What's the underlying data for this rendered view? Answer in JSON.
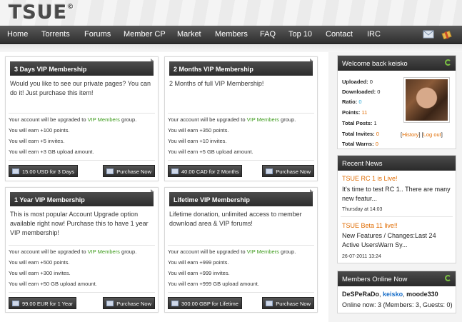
{
  "header": {
    "logo": "TSUE",
    "logo_mark": "©"
  },
  "nav": {
    "items": [
      "Home",
      "Torrents",
      "Forums",
      "Member CP",
      "Market",
      "Members",
      "FAQ",
      "Top 10",
      "Contact",
      "IRC"
    ],
    "mail_icon": "mail-icon",
    "profile_icon": "gift-icon"
  },
  "upgrades": [
    {
      "title": "3 Days VIP Membership",
      "desc": "Would you like to see our private pages? You can do it! Just purchase this item!",
      "group_prefix": "Your account will be upgraded to ",
      "group_name": "VIP Members",
      "group_suffix": " group.",
      "perk1": "You will earn +100 points.",
      "perk2": "You will earn +5 invites.",
      "perk3": "You will earn +3 GB upload amount.",
      "price": "15.00 USD for 3 Days",
      "buy": "Purchase Now"
    },
    {
      "title": "2 Months VIP Membership",
      "desc": "2 Months of full VIP Membership!",
      "group_prefix": "Your account will be upgraded to ",
      "group_name": "VIP Members",
      "group_suffix": " group.",
      "perk1": "You will earn +350 points.",
      "perk2": "You will earn +10 invites.",
      "perk3": "You will earn +5 GB upload amount.",
      "price": "40.00 CAD for 2 Months",
      "buy": "Purchase Now"
    },
    {
      "title": "1 Year VIP Membership",
      "desc": "This is most popular Account Upgrade option available right now! Purchase this to have 1 year VIP membership!",
      "group_prefix": "Your account will be upgraded to ",
      "group_name": "VIP Members",
      "group_suffix": " group.",
      "perk1": "You will earn +500 points.",
      "perk2": "You will earn +300 invites.",
      "perk3": "You will earn +50 GB upload amount.",
      "price": "99.00 EUR for 1 Year",
      "buy": "Purchase Now"
    },
    {
      "title": "Lifetime VIP Membership",
      "desc": "Lifetime donation, unlimited access to member download area & VIP forums!",
      "group_prefix": "Your account will be upgraded to ",
      "group_name": "VIP Members",
      "group_suffix": " group.",
      "perk1": "You will earn +999 points.",
      "perk2": "You will earn +999 invites.",
      "perk3": "You will earn +999 GB upload amount.",
      "price": "300.00 GBP for Lifetime",
      "buy": "Purchase Now"
    }
  ],
  "welcome": {
    "title": "Welcome back keisko",
    "uploaded_label": "Uploaded:",
    "uploaded": "0",
    "downloaded_label": "Downloaded:",
    "downloaded": "0",
    "ratio_label": "Ratio:",
    "ratio": "0",
    "points_label": "Points:",
    "points": "11",
    "total_posts_label": "Total Posts:",
    "total_posts": "1",
    "total_invites_label": "Total Invites:",
    "total_invites": "0",
    "total_warns_label": "Total Warns:",
    "total_warns": "0",
    "history": "History",
    "logout": "Log out",
    "bracket_open": "[",
    "bracket_close": "]"
  },
  "news": {
    "title": "Recent News",
    "items": [
      {
        "title": "TSUE RC 1 is Live!",
        "body": "It's time to test RC 1.. There are many new featur...",
        "date": "Thursday at 14:03"
      },
      {
        "title": "TSUE Beta 11 live!!",
        "body": "New Features / Changes:Last 24 Active UsersWarn Sy...",
        "date": "26-07-2011 13:24"
      }
    ]
  },
  "online": {
    "title": "Members Online Now",
    "member1": "DeSPeRaDo",
    "member2": "keisko",
    "member3": "moode330",
    "sep": ", ",
    "summary": "Online now: 3 (Members: 3, Guests: 0)"
  },
  "colors": {
    "accent_green": "#3c9a1a",
    "accent_orange": "#e06b00",
    "link_blue": "#1a6fc9",
    "ratio_cyan": "#2aa9d6"
  }
}
